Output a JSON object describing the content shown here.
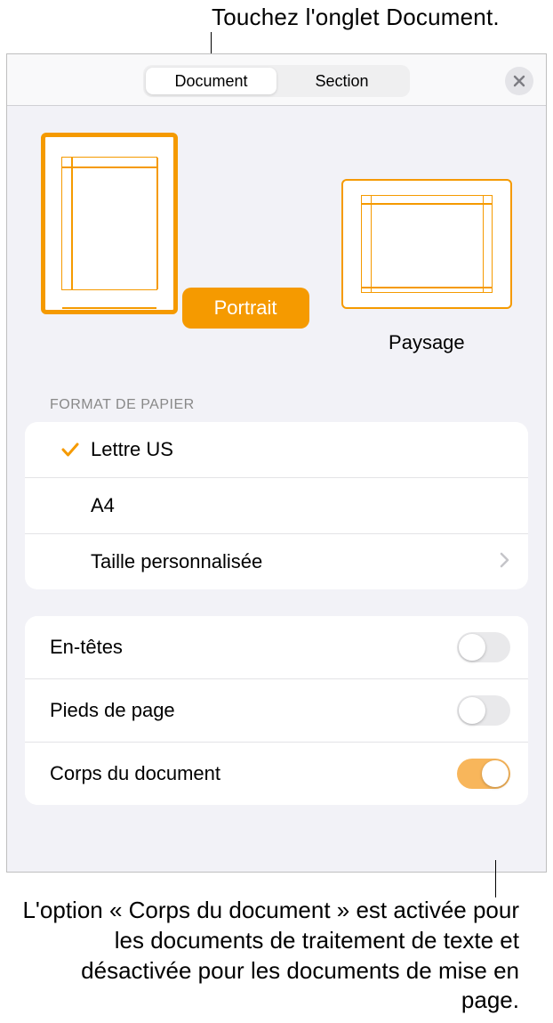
{
  "callouts": {
    "top": "Touchez l'onglet Document.",
    "bottom": "L'option « Corps du document » est activée pour les documents de traitement de texte et désactivée pour les documents de mise en page."
  },
  "tabs": {
    "document": "Document",
    "section": "Section"
  },
  "orientation": {
    "portrait": "Portrait",
    "landscape": "Paysage"
  },
  "paper": {
    "section_title": "FORMAT DE PAPIER",
    "options": {
      "us_letter": "Lettre US",
      "a4": "A4",
      "custom": "Taille personnalisée"
    }
  },
  "toggles": {
    "headers": {
      "label": "En-têtes",
      "on": false
    },
    "footers": {
      "label": "Pieds de page",
      "on": false
    },
    "body": {
      "label": "Corps du document",
      "on": true
    }
  },
  "colors": {
    "accent": "#f59a00"
  }
}
